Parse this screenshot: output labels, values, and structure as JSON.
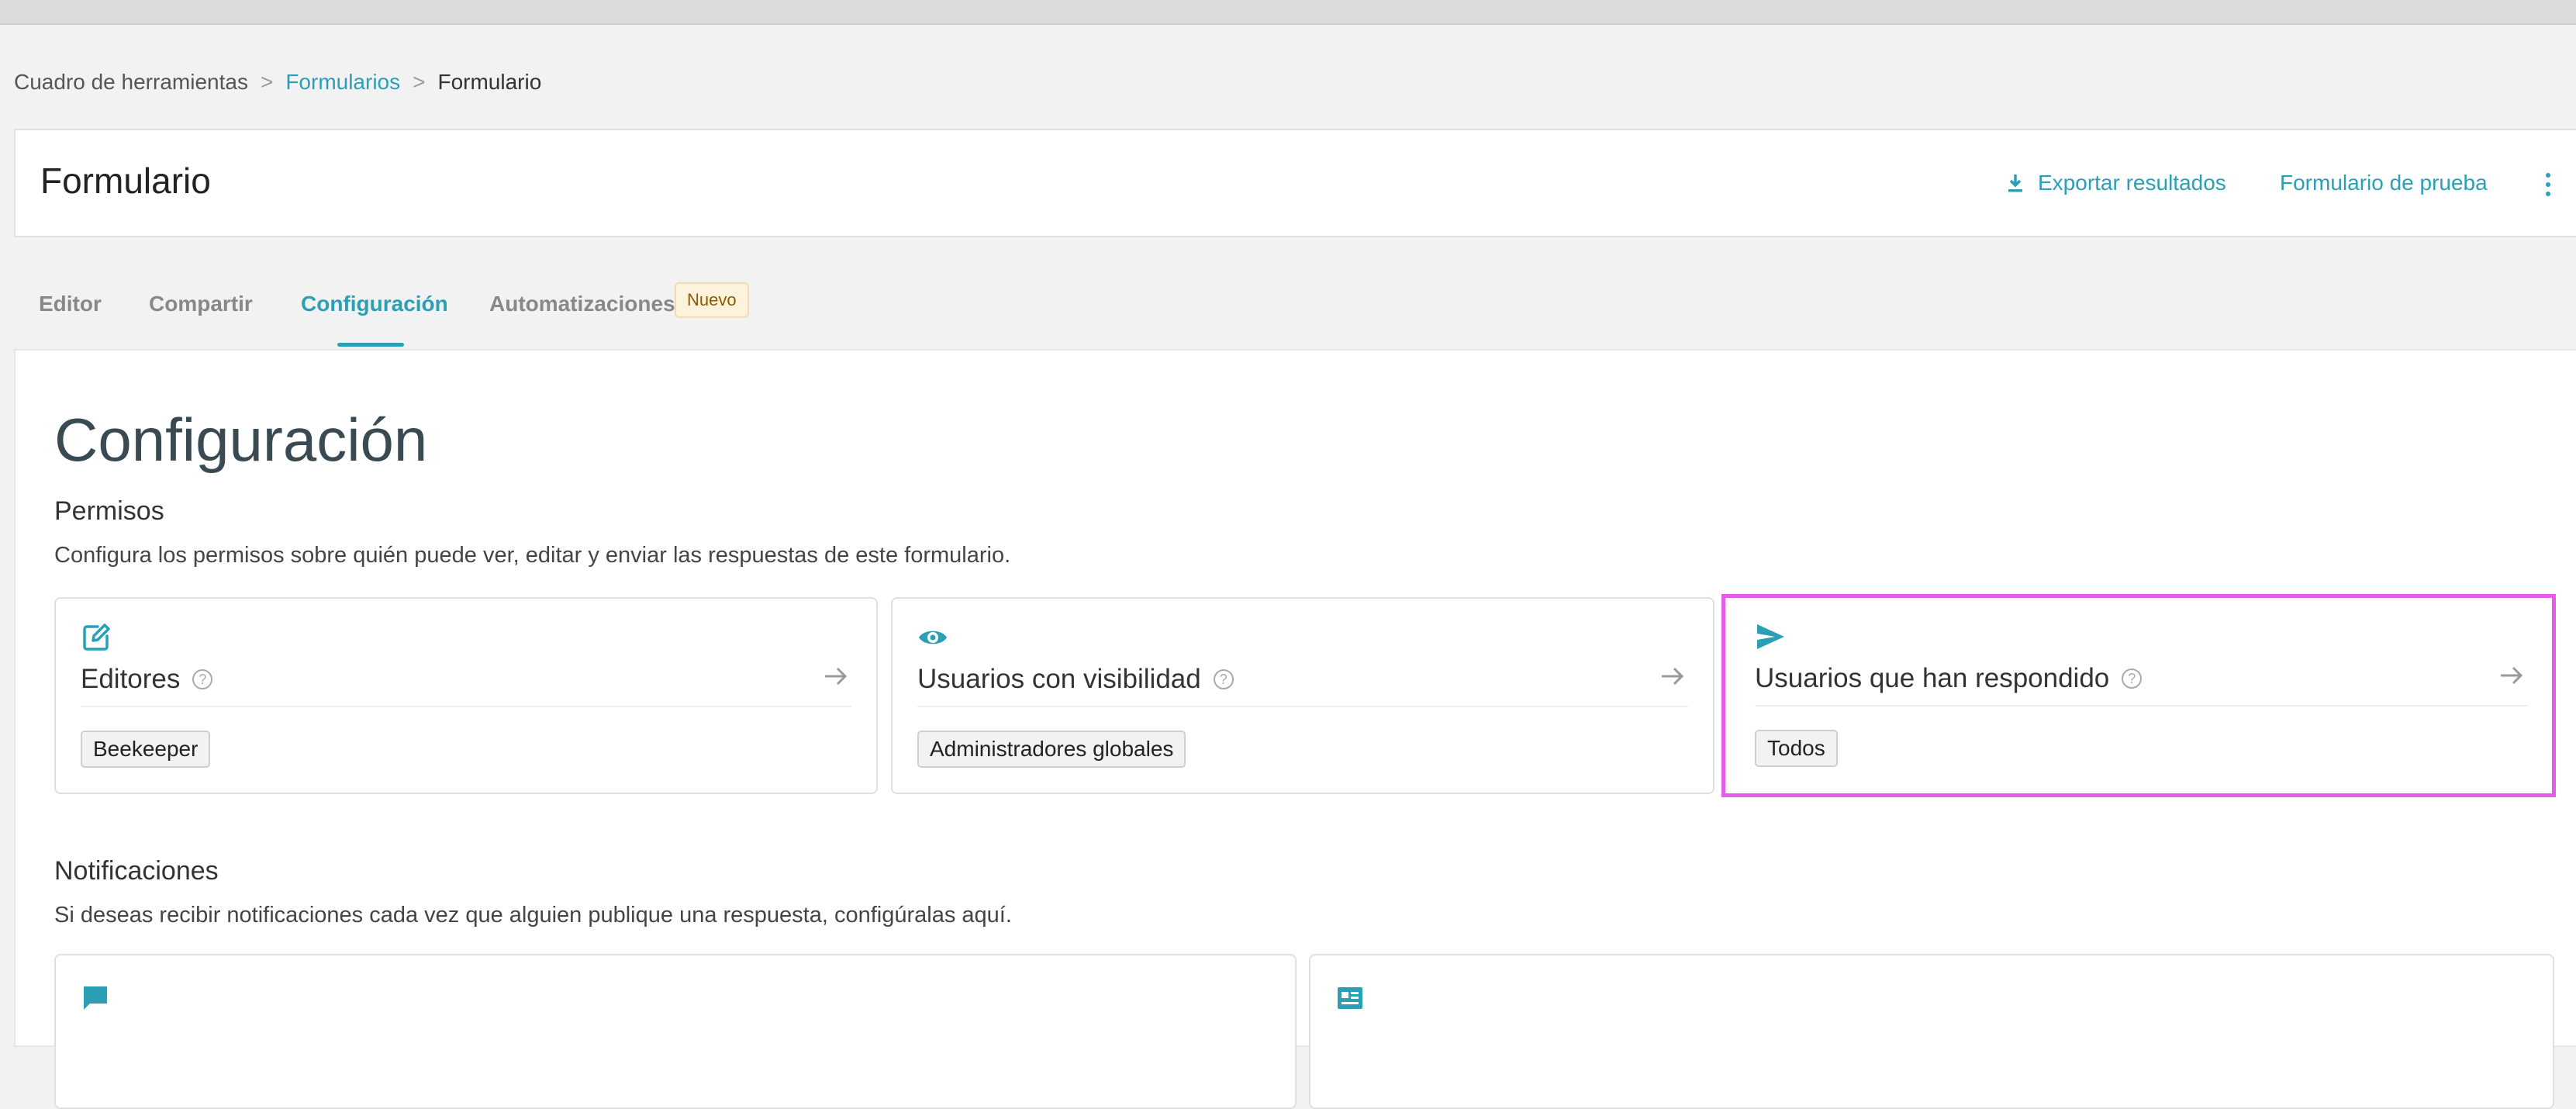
{
  "breadcrumb": {
    "root": "Cuadro de herramientas",
    "sep": ">",
    "parent": "Formularios",
    "current": "Formulario"
  },
  "header": {
    "title": "Formulario",
    "export_label": "Exportar resultados",
    "test_label": "Formulario de prueba"
  },
  "tabs": {
    "editor": "Editor",
    "share": "Compartir",
    "config": "Configuración",
    "automations": "Automatizaciones",
    "new_badge": "Nuevo",
    "active": "Configuración"
  },
  "main": {
    "title": "Configuración",
    "permissions": {
      "title": "Permisos",
      "description": "Configura los permisos sobre quién puede ver, editar y enviar las respuestas de este formulario.",
      "cards": [
        {
          "label": "Editores",
          "tag": "Beekeeper",
          "icon": "edit-icon"
        },
        {
          "label": "Usuarios con visibilidad",
          "tag": "Administradores globales",
          "icon": "eye-icon"
        },
        {
          "label": "Usuarios que han respondido",
          "tag": "Todos",
          "icon": "send-icon"
        }
      ]
    },
    "notifications": {
      "title": "Notificaciones",
      "description": "Si deseas recibir notificaciones cada vez que alguien publique una respuesta, configúralas aquí.",
      "icons": [
        "chat-icon",
        "news-icon"
      ]
    }
  },
  "colors": {
    "accent": "#2a9fb5",
    "highlight": "#e65ce6",
    "badge_bg": "#fdf2dc",
    "background": "#f2f2f2"
  }
}
